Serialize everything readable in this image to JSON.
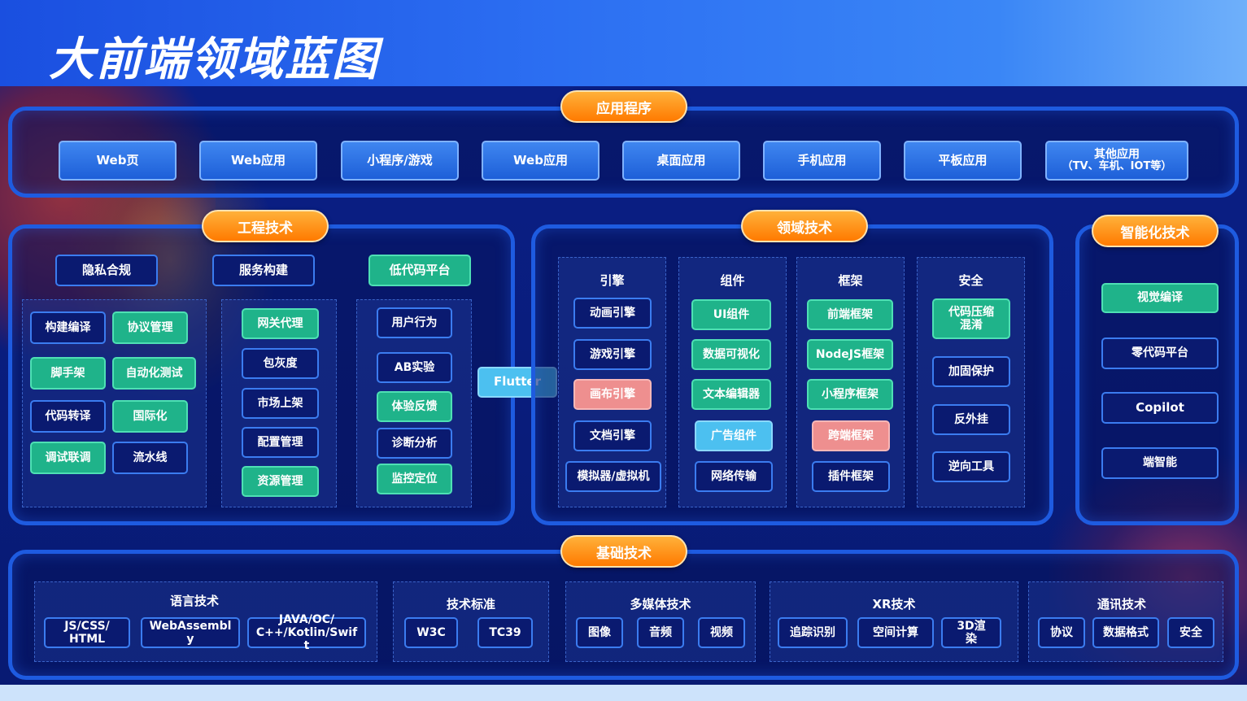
{
  "title": "大前端领域蓝图",
  "application": {
    "title": "应用程序",
    "items": [
      "Web页",
      "Web应用",
      "小程序/游戏",
      "Web应用",
      "桌面应用",
      "手机应用",
      "平板应用"
    ],
    "other": {
      "line1": "其他应用",
      "line2": "（TV、车机、IOT等）"
    }
  },
  "engineering": {
    "title": "工程技术",
    "col1": {
      "head": "隐私合规",
      "items": [
        "构建编译",
        "协议管理",
        "脚手架",
        "自动化测试",
        "代码转译",
        "国际化",
        "调试联调",
        "流水线"
      ]
    },
    "col2": {
      "head": "服务构建",
      "items": [
        "网关代理",
        "包灰度",
        "市场上架",
        "配置管理",
        "资源管理"
      ]
    },
    "col3": {
      "head": "低代码平台",
      "items": [
        "用户行为",
        "AB实验",
        "体验反馈",
        "诊断分析",
        "监控定位"
      ]
    }
  },
  "flutter": "Flutter",
  "domain": {
    "title": "领域技术",
    "engine": {
      "head": "引擎",
      "items": [
        "动画引擎",
        "游戏引擎",
        "画布引擎",
        "文档引擎",
        "模拟器/虚拟机"
      ]
    },
    "component": {
      "head": "组件",
      "items": [
        "UI组件",
        "数据可视化",
        "文本编辑器",
        "广告组件",
        "网络传输"
      ]
    },
    "framework": {
      "head": "框架",
      "items": [
        "前端框架",
        "NodeJS框架",
        "小程序框架",
        "跨端框架",
        "插件框架"
      ]
    },
    "security": {
      "head": "安全",
      "items": [
        "代码压缩",
        "混淆",
        "加固保护",
        "反外挂",
        "逆向工具"
      ]
    }
  },
  "intelligent": {
    "title": "智能化技术",
    "items": [
      "视觉编译",
      "零代码平台",
      "Copilot",
      "端智能"
    ]
  },
  "foundation": {
    "title": "基础技术",
    "language": {
      "head": "语言技术",
      "items": [
        "JS/CSS/",
        "HTML",
        "WebAssembl",
        "y",
        "JAVA/OC/",
        "C++/Kotlin/Swif",
        "t"
      ]
    },
    "standard": {
      "head": "技术标准",
      "items": [
        "W3C",
        "TC39"
      ]
    },
    "media": {
      "head": "多媒体技术",
      "items": [
        "图像",
        "音频",
        "视频"
      ]
    },
    "xr": {
      "head": "XR技术",
      "items": [
        "追踪识别",
        "空间计算",
        "3D渲",
        "染"
      ]
    },
    "comm": {
      "head": "通讯技术",
      "items": [
        "协议",
        "数据格式",
        "安全"
      ]
    }
  }
}
